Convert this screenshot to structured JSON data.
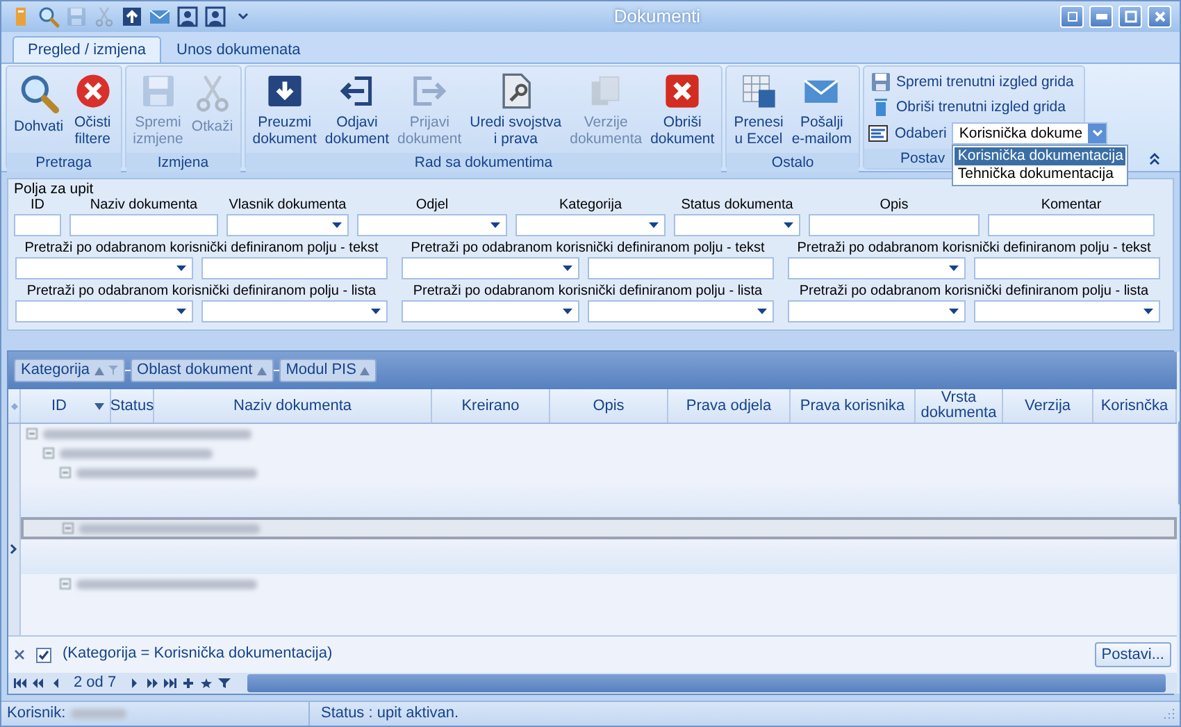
{
  "window": {
    "title": "Dokumenti"
  },
  "quick_access": [
    {
      "kind": "app",
      "disabled": false
    },
    {
      "kind": "search",
      "disabled": false
    },
    {
      "kind": "save",
      "disabled": true
    },
    {
      "kind": "cut",
      "disabled": true
    },
    {
      "kind": "up",
      "disabled": false
    },
    {
      "kind": "email",
      "disabled": false
    },
    {
      "kind": "person",
      "disabled": false
    },
    {
      "kind": "person",
      "disabled": false
    },
    {
      "kind": "more",
      "disabled": false
    }
  ],
  "ribbon": {
    "tabs": [
      {
        "label": "Pregled / izmjena",
        "selected": true
      },
      {
        "label": "Unos dokumenata",
        "selected": false
      }
    ],
    "groups": [
      {
        "label": "Pretraga",
        "buttons": [
          {
            "label": "Dohvati",
            "kind": "search",
            "disabled": false
          },
          {
            "label": "Očisti filtere",
            "kind": "clear",
            "disabled": false
          }
        ]
      },
      {
        "label": "Izmjena",
        "buttons": [
          {
            "label": "Spremi izmjene",
            "kind": "save",
            "disabled": true
          },
          {
            "label": "Otkaži",
            "kind": "cut",
            "disabled": true
          }
        ]
      },
      {
        "label": "Rad sa dokumentima",
        "buttons": [
          {
            "label": "Preuzmi dokument",
            "kind": "download",
            "disabled": false
          },
          {
            "label": "Odjavi dokument",
            "kind": "checkout",
            "disabled": false
          },
          {
            "label": "Prijavi dokument",
            "kind": "checkin",
            "disabled": true
          },
          {
            "label": "Uredi svojstva i prava",
            "kind": "edit",
            "disabled": false
          },
          {
            "label": "Verzije dokumenta",
            "kind": "versions",
            "disabled": true
          },
          {
            "label": "Obriši dokument",
            "kind": "delete",
            "disabled": false
          }
        ]
      },
      {
        "label": "Ostalo",
        "buttons": [
          {
            "label": "Prenesi u Excel",
            "kind": "excel",
            "disabled": false
          },
          {
            "label": "Pošalji e-mailom",
            "kind": "email",
            "disabled": false
          }
        ]
      }
    ],
    "layout_group": {
      "label": "Postav",
      "actions": [
        {
          "label": "Spremi trenutni izgled grida",
          "kind": "save"
        },
        {
          "label": "Obriši trenutni izgled grida",
          "kind": "trash"
        }
      ],
      "select_label": "Odaberi",
      "select_value": "Korisnička dokume",
      "options": [
        {
          "label": "Korisnička dokumentacija",
          "selected": true
        },
        {
          "label": "Tehnička dokumentacija",
          "selected": false
        }
      ]
    }
  },
  "query": {
    "title": "Polja za upit",
    "fields": [
      {
        "label": "ID",
        "kind": "text"
      },
      {
        "label": "Naziv dokumenta",
        "kind": "text"
      },
      {
        "label": "Vlasnik dokumenta",
        "kind": "combo"
      },
      {
        "label": "Odjel",
        "kind": "combo"
      },
      {
        "label": "Kategorija",
        "kind": "combo"
      },
      {
        "label": "Status dokumenta",
        "kind": "combo"
      },
      {
        "label": "Opis",
        "kind": "text"
      },
      {
        "label": "Komentar",
        "kind": "text"
      }
    ],
    "custom_rows": [
      [
        {
          "label": "Pretraži po odabranom korisnički definiranom polju - tekst",
          "kind": "text"
        },
        {
          "label": "Pretraži po odabranom korisnički definiranom polju - tekst",
          "kind": "text"
        },
        {
          "label": "Pretraži po odabranom korisnički definiranom polju - tekst",
          "kind": "text"
        }
      ],
      [
        {
          "label": "Pretraži po odabranom korisnički definiranom polju - lista",
          "kind": "combo"
        },
        {
          "label": "Pretraži po odabranom korisnički definiranom polju - lista",
          "kind": "combo"
        },
        {
          "label": "Pretraži po odabranom korisnički definiranom polju - lista",
          "kind": "combo"
        }
      ]
    ]
  },
  "grid": {
    "group_by": [
      {
        "label": "Kategorija",
        "filtered": true
      },
      {
        "label": "Oblast dokument",
        "filtered": false
      },
      {
        "label": "Modul PIS",
        "filtered": false
      }
    ],
    "columns": [
      {
        "label": "ID",
        "filter_button": true
      },
      {
        "label": "Status"
      },
      {
        "label": "Naziv dokumenta"
      },
      {
        "label": "Kreirano"
      },
      {
        "label": "Opis"
      },
      {
        "label": "Prava odjela"
      },
      {
        "label": "Prava korisnika"
      },
      {
        "label": "Vrsta dokumenta"
      },
      {
        "label": "Verzija"
      },
      {
        "label": "Korisnčka"
      }
    ],
    "rows": [
      {
        "expanded": true,
        "selected": false,
        "children": [
          {
            "expanded": true,
            "selected": false,
            "children": [
              {
                "expanded": true,
                "selected": false
              },
              {
                "expanded": true,
                "selected": true
              },
              {
                "expanded": true,
                "selected": false
              }
            ]
          }
        ]
      }
    ],
    "filter": {
      "checked": true,
      "text": "(Kategorija = Korisnička dokumentacija)",
      "button": "Postavi..."
    },
    "navigator": {
      "position": "2 od 7"
    }
  },
  "status_bar": {
    "user_label": "Korisnik:",
    "status": "Status : upit aktivan."
  }
}
